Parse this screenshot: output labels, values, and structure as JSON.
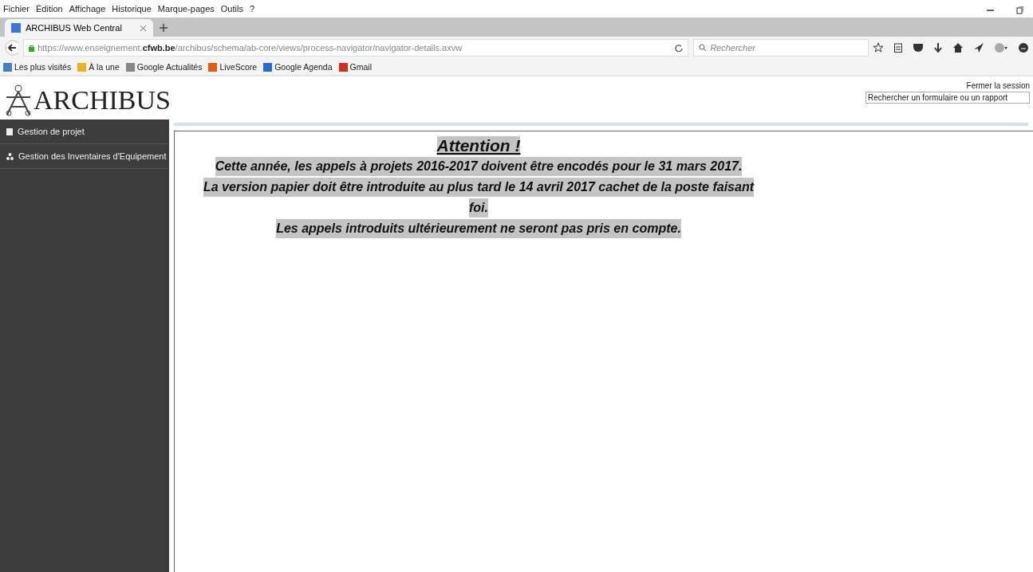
{
  "menu": [
    "Fichier",
    "Édition",
    "Affichage",
    "Historique",
    "Marque-pages",
    "Outils",
    "?"
  ],
  "tabs": [
    {
      "label": "ARCHIBUS Web Central",
      "selected": true
    }
  ],
  "url": {
    "prefix": "https://www.enseignement.",
    "domain": "cfwb.be",
    "suffix": "/archibus/schema/ab-core/views/process-navigator/navigator-details.axvw"
  },
  "browser_search": {
    "placeholder": "Rechercher"
  },
  "bookmarks": [
    "Les plus visités",
    "À la une",
    "Google Actualités",
    "LiveScore",
    "Google Agenda",
    "Gmail"
  ],
  "logo": "ARCHIBUS",
  "header_links": {
    "logout": "Fermer la session",
    "search_placeholder": "Rechercher un formulaire ou un rapport"
  },
  "sidebar": {
    "items": [
      {
        "label": "Gestion de projet",
        "kind": "doc"
      },
      {
        "label": "Gestion des Inventaires d'Equipement",
        "kind": "tree"
      }
    ]
  },
  "notice": {
    "title": "Attention !",
    "lines": [
      "Cette année, les appels à projets 2016-2017 doivent être encodés pour le 31 mars 2017.",
      "La version papier doit être introduite au plus tard le 14 avril 2017 cachet de la poste faisant",
      "foi.",
      "Les appels introduits ultérieurement ne seront pas pris en compte."
    ]
  }
}
